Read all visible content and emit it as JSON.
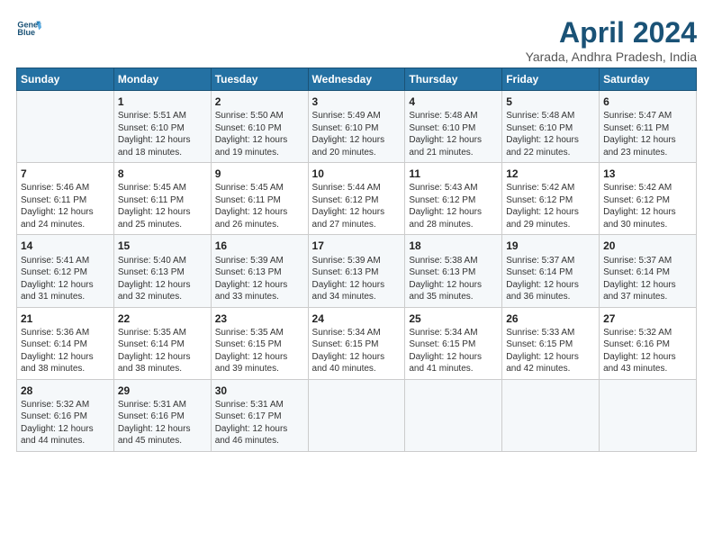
{
  "logo": {
    "line1": "General",
    "line2": "Blue"
  },
  "title": "April 2024",
  "subtitle": "Yarada, Andhra Pradesh, India",
  "columns": [
    "Sunday",
    "Monday",
    "Tuesday",
    "Wednesday",
    "Thursday",
    "Friday",
    "Saturday"
  ],
  "weeks": [
    [
      {
        "day": "",
        "text": ""
      },
      {
        "day": "1",
        "text": "Sunrise: 5:51 AM\nSunset: 6:10 PM\nDaylight: 12 hours\nand 18 minutes."
      },
      {
        "day": "2",
        "text": "Sunrise: 5:50 AM\nSunset: 6:10 PM\nDaylight: 12 hours\nand 19 minutes."
      },
      {
        "day": "3",
        "text": "Sunrise: 5:49 AM\nSunset: 6:10 PM\nDaylight: 12 hours\nand 20 minutes."
      },
      {
        "day": "4",
        "text": "Sunrise: 5:48 AM\nSunset: 6:10 PM\nDaylight: 12 hours\nand 21 minutes."
      },
      {
        "day": "5",
        "text": "Sunrise: 5:48 AM\nSunset: 6:10 PM\nDaylight: 12 hours\nand 22 minutes."
      },
      {
        "day": "6",
        "text": "Sunrise: 5:47 AM\nSunset: 6:11 PM\nDaylight: 12 hours\nand 23 minutes."
      }
    ],
    [
      {
        "day": "7",
        "text": "Sunrise: 5:46 AM\nSunset: 6:11 PM\nDaylight: 12 hours\nand 24 minutes."
      },
      {
        "day": "8",
        "text": "Sunrise: 5:45 AM\nSunset: 6:11 PM\nDaylight: 12 hours\nand 25 minutes."
      },
      {
        "day": "9",
        "text": "Sunrise: 5:45 AM\nSunset: 6:11 PM\nDaylight: 12 hours\nand 26 minutes."
      },
      {
        "day": "10",
        "text": "Sunrise: 5:44 AM\nSunset: 6:12 PM\nDaylight: 12 hours\nand 27 minutes."
      },
      {
        "day": "11",
        "text": "Sunrise: 5:43 AM\nSunset: 6:12 PM\nDaylight: 12 hours\nand 28 minutes."
      },
      {
        "day": "12",
        "text": "Sunrise: 5:42 AM\nSunset: 6:12 PM\nDaylight: 12 hours\nand 29 minutes."
      },
      {
        "day": "13",
        "text": "Sunrise: 5:42 AM\nSunset: 6:12 PM\nDaylight: 12 hours\nand 30 minutes."
      }
    ],
    [
      {
        "day": "14",
        "text": "Sunrise: 5:41 AM\nSunset: 6:12 PM\nDaylight: 12 hours\nand 31 minutes."
      },
      {
        "day": "15",
        "text": "Sunrise: 5:40 AM\nSunset: 6:13 PM\nDaylight: 12 hours\nand 32 minutes."
      },
      {
        "day": "16",
        "text": "Sunrise: 5:39 AM\nSunset: 6:13 PM\nDaylight: 12 hours\nand 33 minutes."
      },
      {
        "day": "17",
        "text": "Sunrise: 5:39 AM\nSunset: 6:13 PM\nDaylight: 12 hours\nand 34 minutes."
      },
      {
        "day": "18",
        "text": "Sunrise: 5:38 AM\nSunset: 6:13 PM\nDaylight: 12 hours\nand 35 minutes."
      },
      {
        "day": "19",
        "text": "Sunrise: 5:37 AM\nSunset: 6:14 PM\nDaylight: 12 hours\nand 36 minutes."
      },
      {
        "day": "20",
        "text": "Sunrise: 5:37 AM\nSunset: 6:14 PM\nDaylight: 12 hours\nand 37 minutes."
      }
    ],
    [
      {
        "day": "21",
        "text": "Sunrise: 5:36 AM\nSunset: 6:14 PM\nDaylight: 12 hours\nand 38 minutes."
      },
      {
        "day": "22",
        "text": "Sunrise: 5:35 AM\nSunset: 6:14 PM\nDaylight: 12 hours\nand 38 minutes."
      },
      {
        "day": "23",
        "text": "Sunrise: 5:35 AM\nSunset: 6:15 PM\nDaylight: 12 hours\nand 39 minutes."
      },
      {
        "day": "24",
        "text": "Sunrise: 5:34 AM\nSunset: 6:15 PM\nDaylight: 12 hours\nand 40 minutes."
      },
      {
        "day": "25",
        "text": "Sunrise: 5:34 AM\nSunset: 6:15 PM\nDaylight: 12 hours\nand 41 minutes."
      },
      {
        "day": "26",
        "text": "Sunrise: 5:33 AM\nSunset: 6:15 PM\nDaylight: 12 hours\nand 42 minutes."
      },
      {
        "day": "27",
        "text": "Sunrise: 5:32 AM\nSunset: 6:16 PM\nDaylight: 12 hours\nand 43 minutes."
      }
    ],
    [
      {
        "day": "28",
        "text": "Sunrise: 5:32 AM\nSunset: 6:16 PM\nDaylight: 12 hours\nand 44 minutes."
      },
      {
        "day": "29",
        "text": "Sunrise: 5:31 AM\nSunset: 6:16 PM\nDaylight: 12 hours\nand 45 minutes."
      },
      {
        "day": "30",
        "text": "Sunrise: 5:31 AM\nSunset: 6:17 PM\nDaylight: 12 hours\nand 46 minutes."
      },
      {
        "day": "",
        "text": ""
      },
      {
        "day": "",
        "text": ""
      },
      {
        "day": "",
        "text": ""
      },
      {
        "day": "",
        "text": ""
      }
    ]
  ]
}
